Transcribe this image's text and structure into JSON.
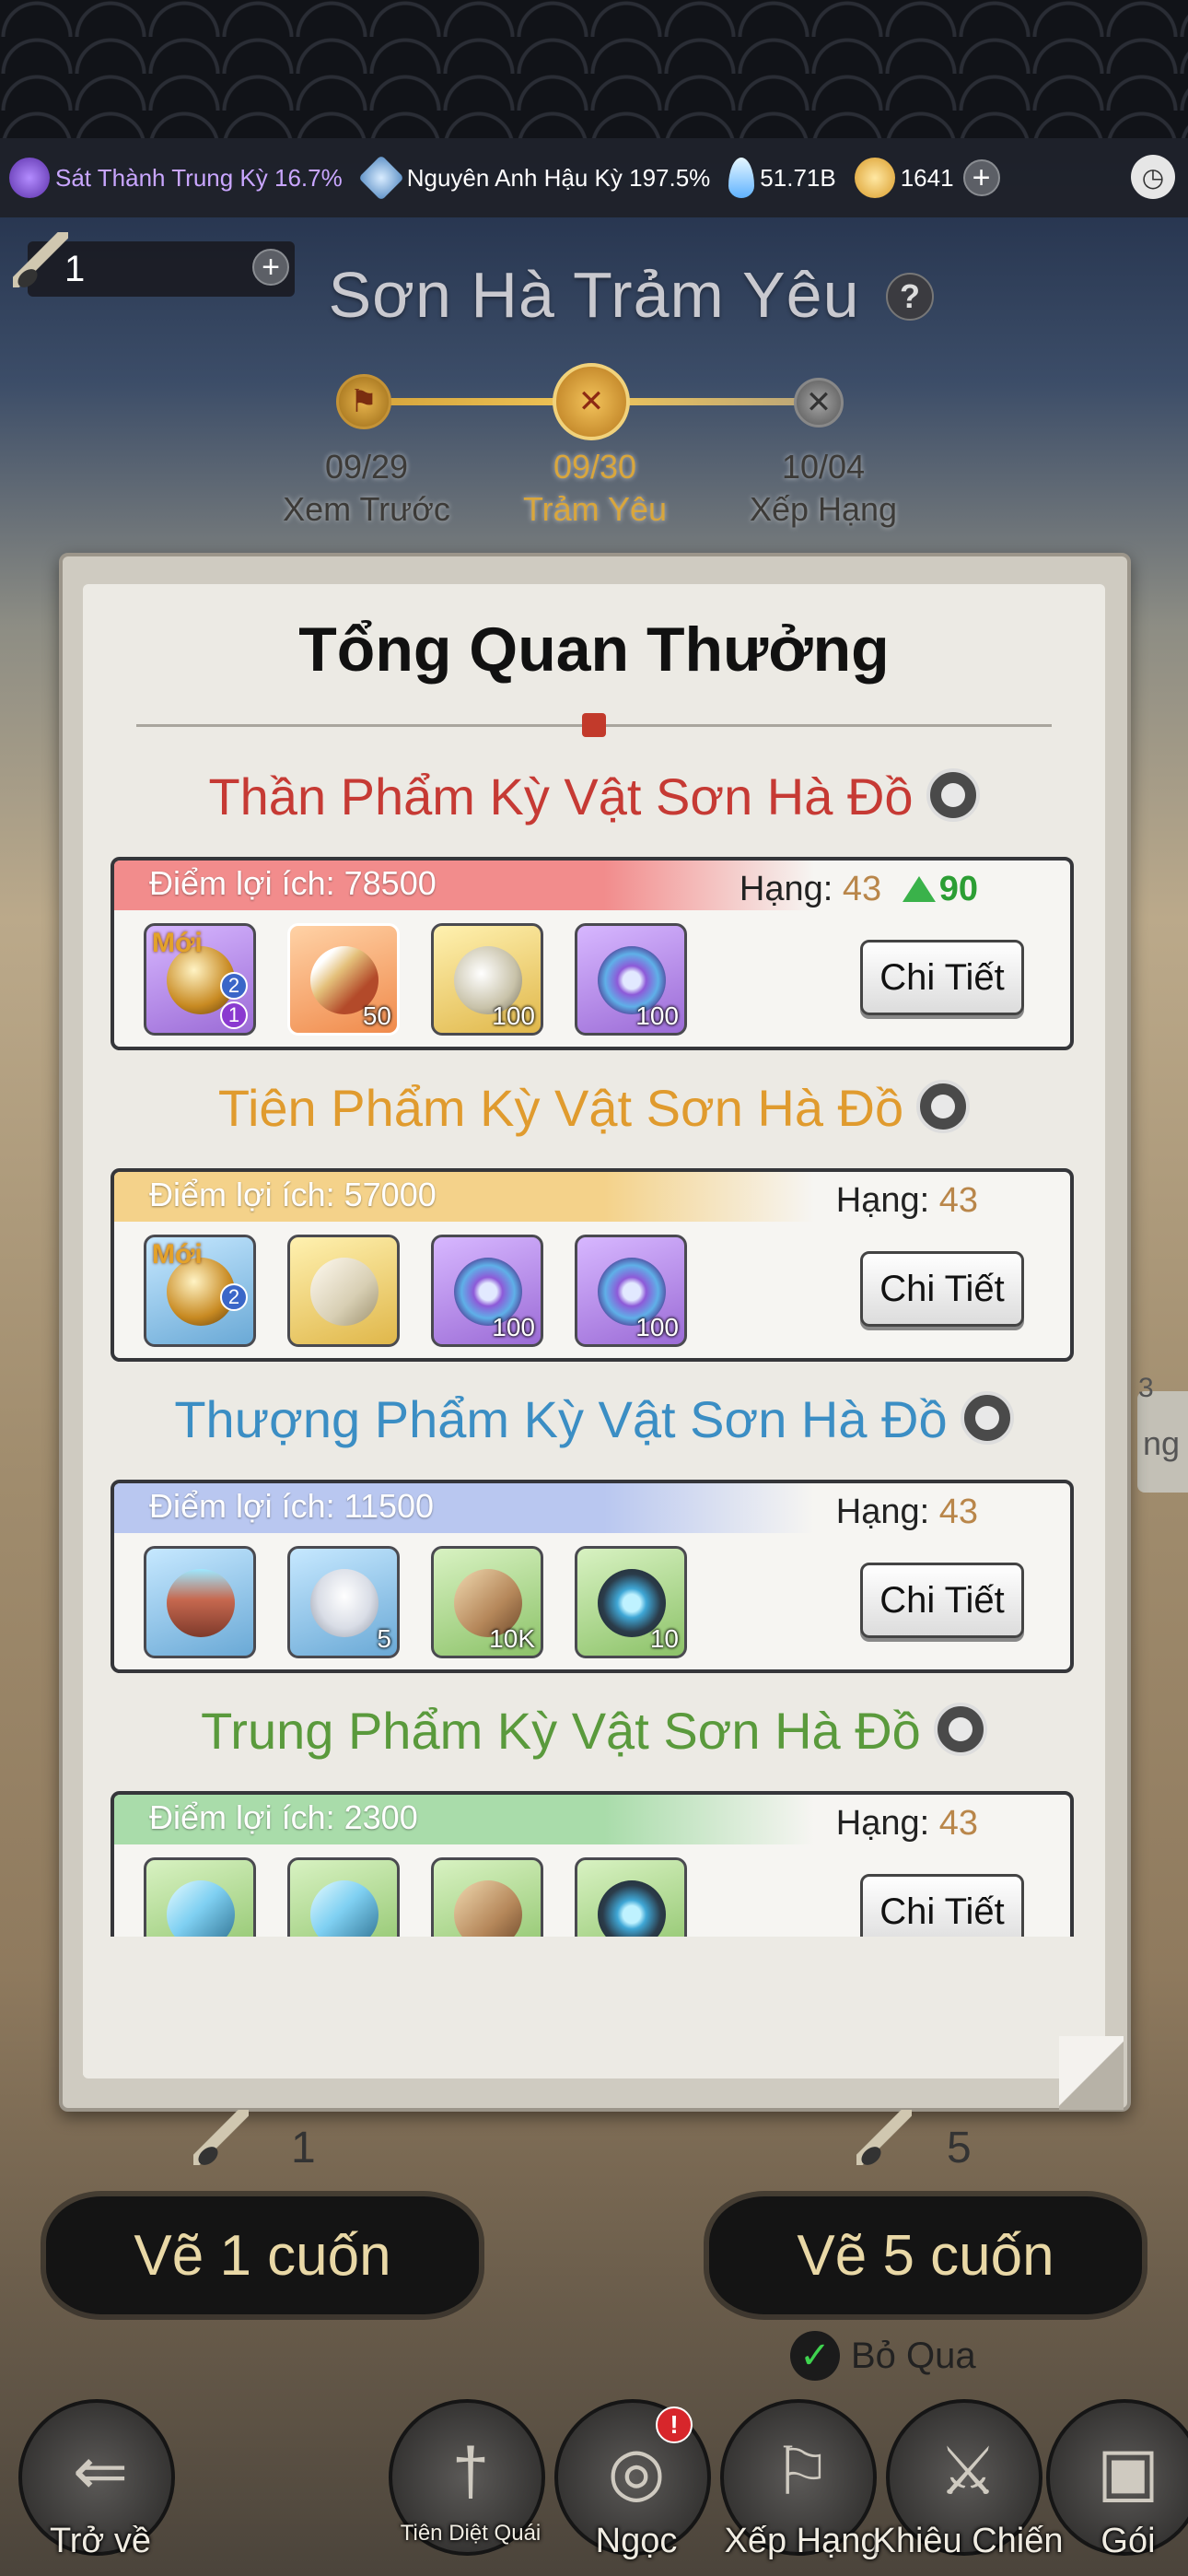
{
  "status_bar": {
    "realm": "Sát Thành Trung Kỳ 16.7%",
    "cultivation": "Nguyên Anh Hậu Kỳ 197.5%",
    "spirit_stones": "51.71B",
    "gold": "1641"
  },
  "ticket": {
    "count": "1"
  },
  "event": {
    "title": "Sơn Hà Trảm Yêu",
    "stages": [
      {
        "date": "09/29",
        "name": "Xem Trước",
        "active": false
      },
      {
        "date": "09/30",
        "name": "Trảm Yêu",
        "active": true
      },
      {
        "date": "10/04",
        "name": "Xếp Hạng",
        "active": false
      }
    ]
  },
  "side_right": {
    "top_label": "3",
    "tab_label": "ng"
  },
  "panel": {
    "title": "Tổng Quan Thưởng",
    "tiers": [
      {
        "title": "Thần Phẩm  Kỳ Vật Sơn Hà Đồ",
        "title_color": "#c63a34",
        "band_color": "#f28c8c",
        "points": "Điểm lợi ích: 78500",
        "rank_label": "Hạng:",
        "rank": "43",
        "rank_up": "90",
        "detail": "Chi Tiết",
        "items": [
          {
            "icon": "golden-orb-icon",
            "bg": "purple",
            "new": "Mới",
            "badge_top": "2",
            "badge_bottom": "1",
            "qty": ""
          },
          {
            "icon": "scroll-sword-icon",
            "bg": "orange",
            "qty": "50"
          },
          {
            "icon": "silver-hook-icon",
            "bg": "yellow",
            "qty": "100"
          },
          {
            "icon": "jade-disc-icon",
            "bg": "purple",
            "qty": "100"
          }
        ]
      },
      {
        "title": "Tiên Phẩm  Kỳ Vật Sơn Hà Đồ",
        "title_color": "#e09b2e",
        "band_color": "#f4d28a",
        "points": "Điểm lợi ích: 57000",
        "rank_label": "Hạng:",
        "rank": "43",
        "detail": "Chi Tiết",
        "items": [
          {
            "icon": "golden-orb-icon",
            "bg": "blue",
            "new": "Mới",
            "badge_top": "2",
            "qty": ""
          },
          {
            "icon": "paper-scroll-icon",
            "bg": "yellow",
            "qty": ""
          },
          {
            "icon": "jade-disc-icon",
            "bg": "purple",
            "qty": "100"
          },
          {
            "icon": "jade-disc-icon",
            "bg": "purple",
            "qty": "100"
          }
        ]
      },
      {
        "title": "Thượng Phẩm  Kỳ Vật Sơn Hà Đồ",
        "title_color": "#3b8ec4",
        "band_color": "#b9c7f0",
        "points": "Điểm lợi ích: 11500",
        "rank_label": "Hạng:",
        "rank": "43",
        "detail": "Chi Tiết",
        "items": [
          {
            "icon": "treasure-chest-icon",
            "bg": "blue",
            "qty": ""
          },
          {
            "icon": "silver-ingot-icon",
            "bg": "blue",
            "qty": "5"
          },
          {
            "icon": "bamboo-scroll-icon",
            "bg": "green",
            "qty": "10K"
          },
          {
            "icon": "dark-amulet-icon",
            "bg": "green",
            "qty": "10"
          }
        ]
      },
      {
        "title": "Trung Phẩm  Kỳ Vật Sơn Hà Đồ",
        "title_color": "#5a9a3c",
        "band_color": "#a9dcaa",
        "points": "Điểm lợi ích: 2300",
        "rank_label": "Hạng:",
        "rank": "43",
        "detail": "Chi Tiết",
        "items": [
          {
            "icon": "crystal-staff-icon",
            "bg": "green",
            "qty": ""
          },
          {
            "icon": "crystal-staff-icon",
            "bg": "green",
            "qty": ""
          },
          {
            "icon": "bamboo-scroll-icon",
            "bg": "green",
            "qty": ""
          },
          {
            "icon": "dark-amulet-icon",
            "bg": "green",
            "qty": ""
          }
        ]
      }
    ]
  },
  "draw": {
    "one_count": "1",
    "one_label": "Vẽ 1 cuốn",
    "five_count": "5",
    "five_label": "Vẽ 5 cuốn",
    "skip_label": "Bỏ Qua"
  },
  "nav": [
    {
      "label": "Trở về",
      "icon": "back-arrow-icon"
    },
    {
      "label": "Tiên Diệt Quái",
      "icon": "sword-icon"
    },
    {
      "label": "Ngọc",
      "icon": "orb-swirl-icon",
      "notif": "!"
    },
    {
      "label": "Xếp Hạng",
      "icon": "banner-icon"
    },
    {
      "label": "Khiêu Chiến",
      "icon": "crossed-swords-icon"
    },
    {
      "label": "Gói",
      "icon": "chest-icon"
    }
  ]
}
